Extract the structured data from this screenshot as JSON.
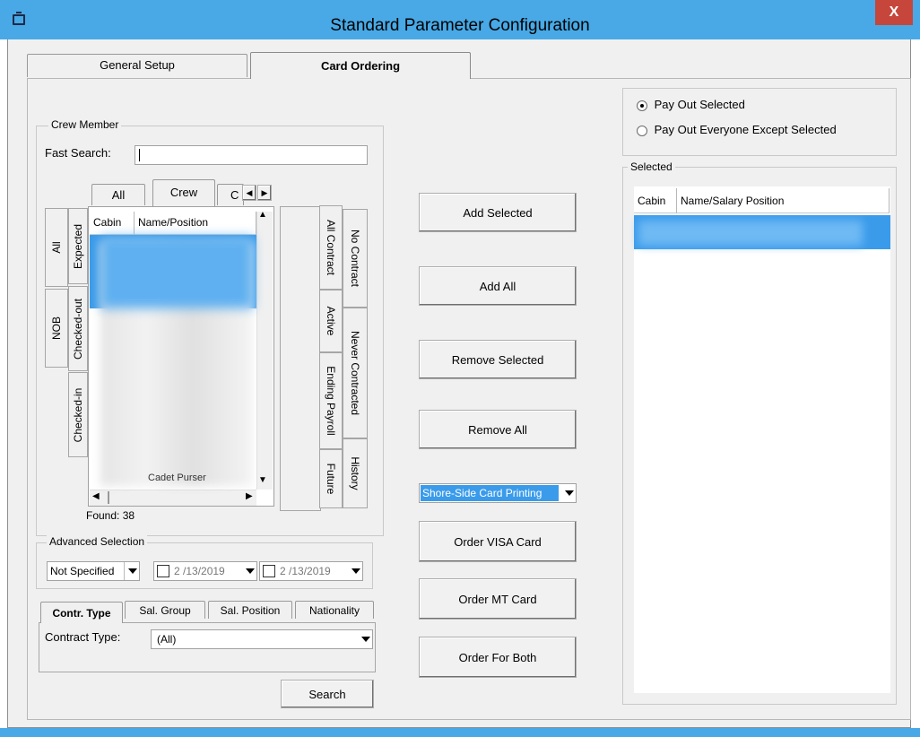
{
  "window": {
    "title": "Standard Parameter Configuration",
    "close": "X"
  },
  "tabs": [
    "General Setup",
    "Card Ordering"
  ],
  "crew": {
    "legend": "Crew Member",
    "fast_search_label": "Fast Search:",
    "fast_search_value": "",
    "inner_tabs": [
      "All",
      "Crew",
      "C"
    ],
    "left_tabs": [
      "All",
      "Expected",
      "NOB",
      "Checked-out",
      "Checked-in"
    ],
    "right_tabs": [
      "All Contract",
      "No Contract",
      "Active",
      "Never Contracted",
      "Ending Payroll",
      "History",
      "Future"
    ],
    "columns": [
      "Cabin",
      "Name/Position"
    ],
    "partial_row_text": "Cadet Purser",
    "found": "Found: 38"
  },
  "advanced": {
    "legend": "Advanced Selection",
    "select_value": "Not Specified",
    "date1": "2 /13/2019",
    "date2": "2 /13/2019"
  },
  "filter_tabs": [
    "Contr. Type",
    "Sal. Group",
    "Sal. Position",
    "Nationality"
  ],
  "contract": {
    "label": "Contract Type:",
    "value": "(All)"
  },
  "search_button": "Search",
  "middle": {
    "add_selected": "Add Selected",
    "add_all": "Add All",
    "remove_selected": "Remove Selected",
    "remove_all": "Remove All",
    "printing_value": "Shore-Side Card Printing",
    "order_visa": "Order VISA Card",
    "order_mt": "Order MT Card",
    "order_both": "Order For Both"
  },
  "payout": {
    "option1": "Pay Out Selected",
    "option2": "Pay Out Everyone Except Selected"
  },
  "selected": {
    "legend": "Selected",
    "columns": [
      "Cabin",
      "Name/Salary Position"
    ]
  },
  "colors": {
    "titlebar": "#48a9e6",
    "selection": "#3a9bea",
    "close": "#c7463b"
  }
}
